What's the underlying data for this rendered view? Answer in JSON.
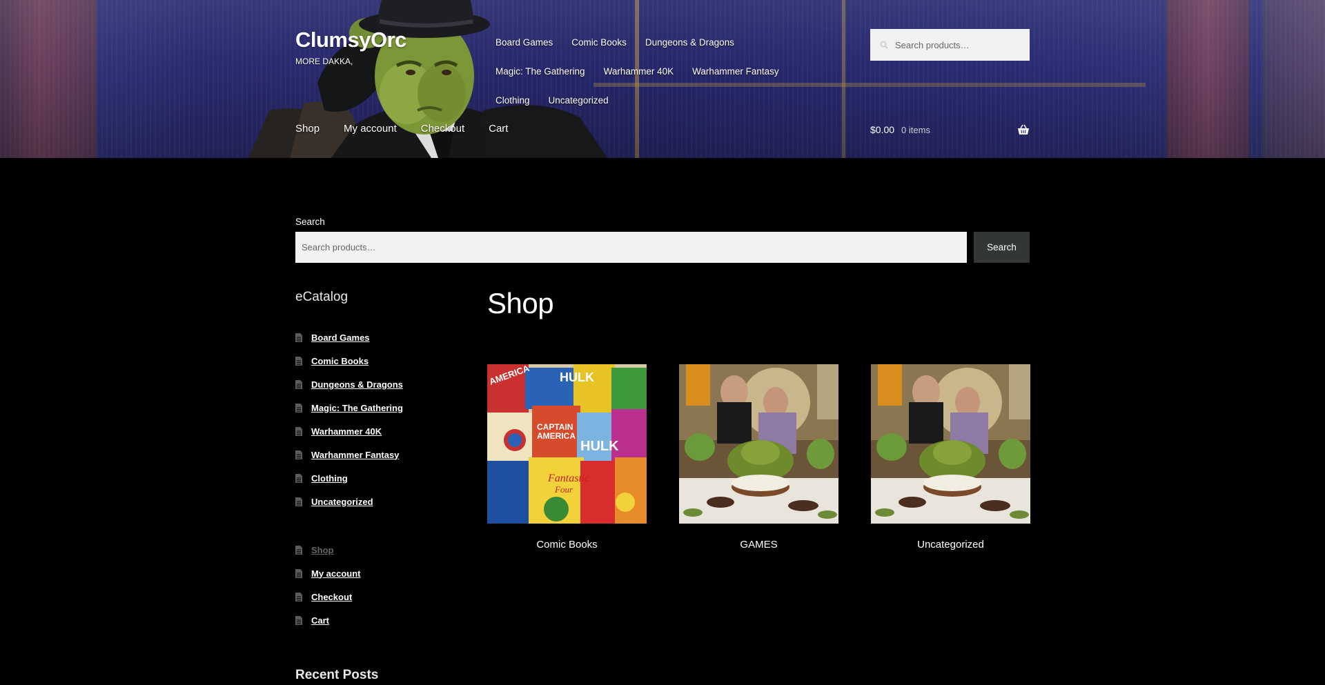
{
  "header": {
    "site_title": "ClumsyOrc",
    "tagline": "MORE DAKKA,",
    "secondary_nav": [
      "Board Games",
      "Comic Books",
      "Dungeons & Dragons",
      "Magic: The Gathering",
      "Warhammer 40K",
      "Warhammer Fantasy",
      "Clothing",
      "Uncategorized"
    ],
    "search_placeholder": "Search products…",
    "primary_nav": [
      "Shop",
      "My account",
      "Checkout",
      "Cart"
    ],
    "cart": {
      "amount": "$0.00",
      "count": "0 items"
    }
  },
  "search_widget": {
    "label": "Search",
    "placeholder": "Search products…",
    "button": "Search"
  },
  "sidebar": {
    "catalog_title": "eCatalog",
    "categories": [
      "Board Games",
      "Comic Books",
      "Dungeons & Dragons",
      "Magic: The Gathering",
      "Warhammer 40K",
      "Warhammer Fantasy",
      "Clothing",
      "Uncategorized"
    ],
    "pages": [
      "Shop",
      "My account",
      "Checkout",
      "Cart"
    ],
    "current_page": "Shop",
    "recent_posts_title": "Recent Posts"
  },
  "main": {
    "title": "Shop",
    "products": [
      {
        "name": "Comic Books",
        "image": "comic-collage"
      },
      {
        "name": "GAMES",
        "image": "orc-dinner"
      },
      {
        "name": "Uncategorized",
        "image": "orc-dinner"
      }
    ]
  },
  "colors": {
    "background": "#000000",
    "input_bg": "#f2f2f2",
    "button_bg": "#333637",
    "header_blue": "#2e2f7a",
    "muted_link": "#666666"
  }
}
